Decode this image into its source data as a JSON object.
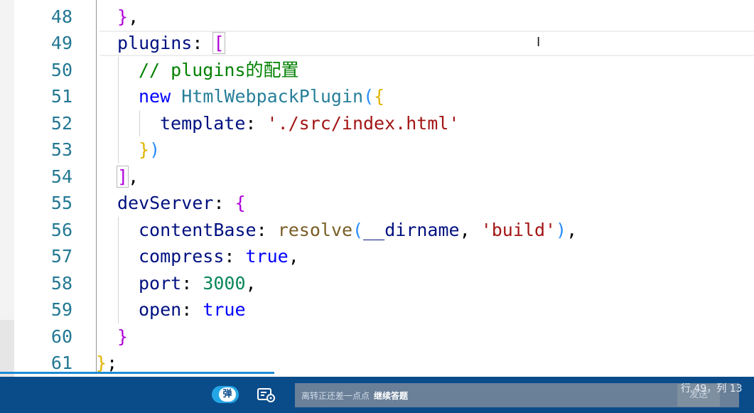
{
  "editor": {
    "lines": [
      {
        "n": "48"
      },
      {
        "n": "49"
      },
      {
        "n": "50"
      },
      {
        "n": "51"
      },
      {
        "n": "52"
      },
      {
        "n": "53"
      },
      {
        "n": "54"
      },
      {
        "n": "55"
      },
      {
        "n": "56"
      },
      {
        "n": "57"
      },
      {
        "n": "58"
      },
      {
        "n": "59"
      },
      {
        "n": "60"
      },
      {
        "n": "61"
      }
    ],
    "tokens": {
      "l48_close": "}",
      "l48_comma": ",",
      "l49_key": "plugins",
      "l49_colon": ": ",
      "l49_open": "[",
      "l50_comment": "// plugins的配置",
      "l51_new": "new ",
      "l51_cls": "HtmlWebpackPlugin",
      "l51_paren": "(",
      "l51_brace": "{",
      "l52_key": "template",
      "l52_colon": ": ",
      "l52_str": "'./src/index.html'",
      "l53_brace": "}",
      "l53_paren": ")",
      "l54_close": "]",
      "l54_comma": ",",
      "l55_key": "devServer",
      "l55_colon": ": ",
      "l55_open": "{",
      "l56_key": "contentBase",
      "l56_colon": ": ",
      "l56_fn": "resolve",
      "l56_paren": "(",
      "l56_arg": "__dirname",
      "l56_comma": ", ",
      "l56_str": "'build'",
      "l56_paren2": ")",
      "l56_comma2": ",",
      "l57_key": "compress",
      "l57_colon": ": ",
      "l57_val": "true",
      "l57_comma": ",",
      "l58_key": "port",
      "l58_colon": ": ",
      "l58_val": "3000",
      "l58_comma": ",",
      "l59_key": "open",
      "l59_colon": ": ",
      "l59_val": "true",
      "l60_close": "}",
      "l61_close": "}",
      "l61_semi": ";"
    }
  },
  "player": {
    "danmu_toggle_label": "弹",
    "message_placeholder": "离转正还差一点点",
    "message_action": "继续答题",
    "send_label": "发送",
    "cursor_position": "行 49，列 13",
    "progress_fraction": 0.364
  },
  "colors": {
    "line_number": "#237893",
    "keyword": "#0000ff",
    "string": "#a31515",
    "number": "#098658",
    "comment": "#008000",
    "taskbar": "#0a4c8a",
    "progress": "#1e8ad6"
  },
  "icons": {
    "danmu_settings": "danmu-settings-icon",
    "text_cursor": "text-cursor-icon"
  }
}
